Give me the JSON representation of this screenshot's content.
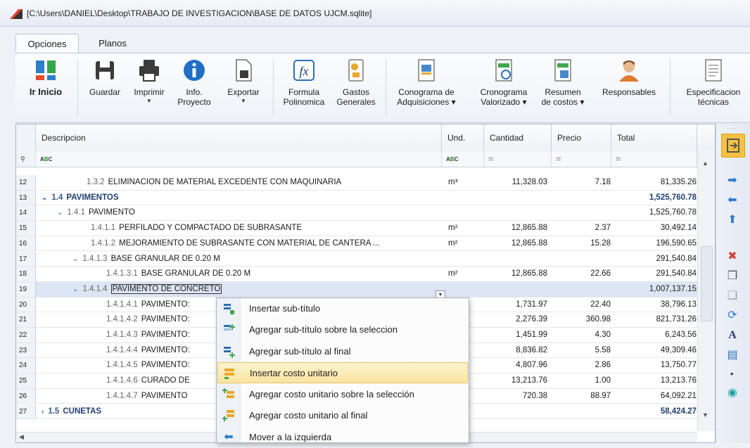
{
  "window": {
    "title": "[C:\\Users\\DANIEL\\Desktop\\TRABAJO DE INVESTIGACION\\BASE DE DATOS UJCM.sqlite]"
  },
  "tabs": [
    {
      "label": "Opciones"
    },
    {
      "label": "Planos"
    }
  ],
  "ribbon": {
    "ir_inicio": "Ir Inicio",
    "guardar": "Guardar",
    "imprimir": "Imprimir",
    "info_1": "Info.",
    "info_2": "Proyecto",
    "exportar": "Exportar",
    "formula_1": "Formula",
    "formula_2": "Polinomica",
    "gastos_1": "Gastos",
    "gastos_2": "Generales",
    "conograma_1": "Conograma de",
    "conograma_2": "Adquisiciones",
    "cronograma_1": "Cronograma",
    "cronograma_2": "Valorizado",
    "resumen_1": "Resumen",
    "resumen_2": "de costos",
    "responsables": "Responsables",
    "especificacion_1": "Especificacion",
    "especificacion_2": "técnicas"
  },
  "grid": {
    "columns": {
      "descripcion": "Descripcion",
      "und": "Und.",
      "cantidad": "Cantidad",
      "precio": "Precio",
      "total": "Total"
    },
    "filter": {
      "pin": "▼",
      "abc_a": "A",
      "abc_b": "B",
      "abc_c": "C",
      "eq": "="
    },
    "rows": [
      {
        "n": "12",
        "code": "1.3.2",
        "desc": "ELIMINACION DE MATERIAL EXCEDENTE CON MAQUINARIA",
        "und": "m³",
        "cant": "11,328.03",
        "prec": "7.18",
        "total": "81,335.26"
      },
      {
        "n": "13",
        "toggle": "⌄",
        "code": "1.4",
        "desc": "PAVIMENTOS",
        "und": "",
        "cant": "",
        "prec": "",
        "total": "1,525,760.78"
      },
      {
        "n": "14",
        "toggle": "⌄",
        "code": "1.4.1",
        "desc": "PAVIMENTO",
        "und": "",
        "cant": "",
        "prec": "",
        "total": "1,525,760.78"
      },
      {
        "n": "15",
        "code": "1.4.1.1",
        "desc": "PERFILADO Y COMPACTADO DE SUBRASANTE",
        "und": "m²",
        "cant": "12,865.88",
        "prec": "2.37",
        "total": "30,492.14"
      },
      {
        "n": "16",
        "code": "1.4.1.2",
        "desc": "MEJORAMIENTO DE SUBRASANTE CON MATERIAL DE CANTERA ...",
        "und": "m²",
        "cant": "12,865.88",
        "prec": "15.28",
        "total": "196,590.65"
      },
      {
        "n": "17",
        "toggle": "⌄",
        "code": "1.4.1.3",
        "desc": "BASE GRANULAR DE 0.20 M",
        "und": "",
        "cant": "",
        "prec": "",
        "total": "291,540.84"
      },
      {
        "n": "18",
        "code": "1.4.1.3.1",
        "desc": "BASE GRANULAR DE 0.20 M",
        "und": "m²",
        "cant": "12,865.88",
        "prec": "22.66",
        "total": "291,540.84"
      },
      {
        "n": "19",
        "toggle": "⌄",
        "code": "1.4.1.4",
        "desc": "PAVIMENTO DE CONCRETO",
        "und": "",
        "cant": "",
        "prec": "",
        "total": "1,007,137.15"
      },
      {
        "n": "20",
        "code": "1.4.1.4.1",
        "desc": "PAVIMENTO:",
        "und": "",
        "cant": "1,731.97",
        "prec": "22.40",
        "total": "38,796.13"
      },
      {
        "n": "21",
        "code": "1.4.1.4.2",
        "desc": "PAVIMENTO:",
        "und": "",
        "cant": "2,276.39",
        "prec": "360.98",
        "total": "821,731.26"
      },
      {
        "n": "22",
        "code": "1.4.1.4.3",
        "desc": "PAVIMENTO:",
        "und": "",
        "cant": "1,451.99",
        "prec": "4.30",
        "total": "6,243.56"
      },
      {
        "n": "23",
        "code": "1.4.1.4.4",
        "desc": "PAVIMENTO:",
        "und": "",
        "cant": "8,836.82",
        "prec": "5.58",
        "total": "49,309.46"
      },
      {
        "n": "24",
        "code": "1.4.1.4.5",
        "desc": "PAVIMENTO:",
        "und": "",
        "cant": "4,807.96",
        "prec": "2.86",
        "total": "13,750.77"
      },
      {
        "n": "25",
        "code": "1.4.1.4.6",
        "desc": "CURADO DE",
        "und": "",
        "cant": "13,213.76",
        "prec": "1.00",
        "total": "13,213.76"
      },
      {
        "n": "26",
        "code": "1.4.1.4.7",
        "desc": "PAVIMENTO",
        "und": "",
        "cant": "720.38",
        "prec": "88.97",
        "total": "64,092.21"
      },
      {
        "n": "27",
        "toggle": "›",
        "code": "1.5",
        "desc": "CUNETAS",
        "und": "",
        "cant": "",
        "prec": "",
        "total": "58,424.27"
      }
    ]
  },
  "context_menu": {
    "items": [
      {
        "label": "Insertar sub-título"
      },
      {
        "label": "Agregar sub-título sobre la seleccion"
      },
      {
        "label": "Agregar sub-título al final"
      },
      {
        "label": "Insertar costo unitario"
      },
      {
        "label": "Agregar costo unitario sobre la selección"
      },
      {
        "label": "Agregar costo unitario al final"
      },
      {
        "label": "Mover a la izquierda"
      }
    ]
  },
  "colors": {
    "accent": "#f6c141",
    "selection": "#dbe5f3",
    "bold_text": "#1f3e6e"
  }
}
